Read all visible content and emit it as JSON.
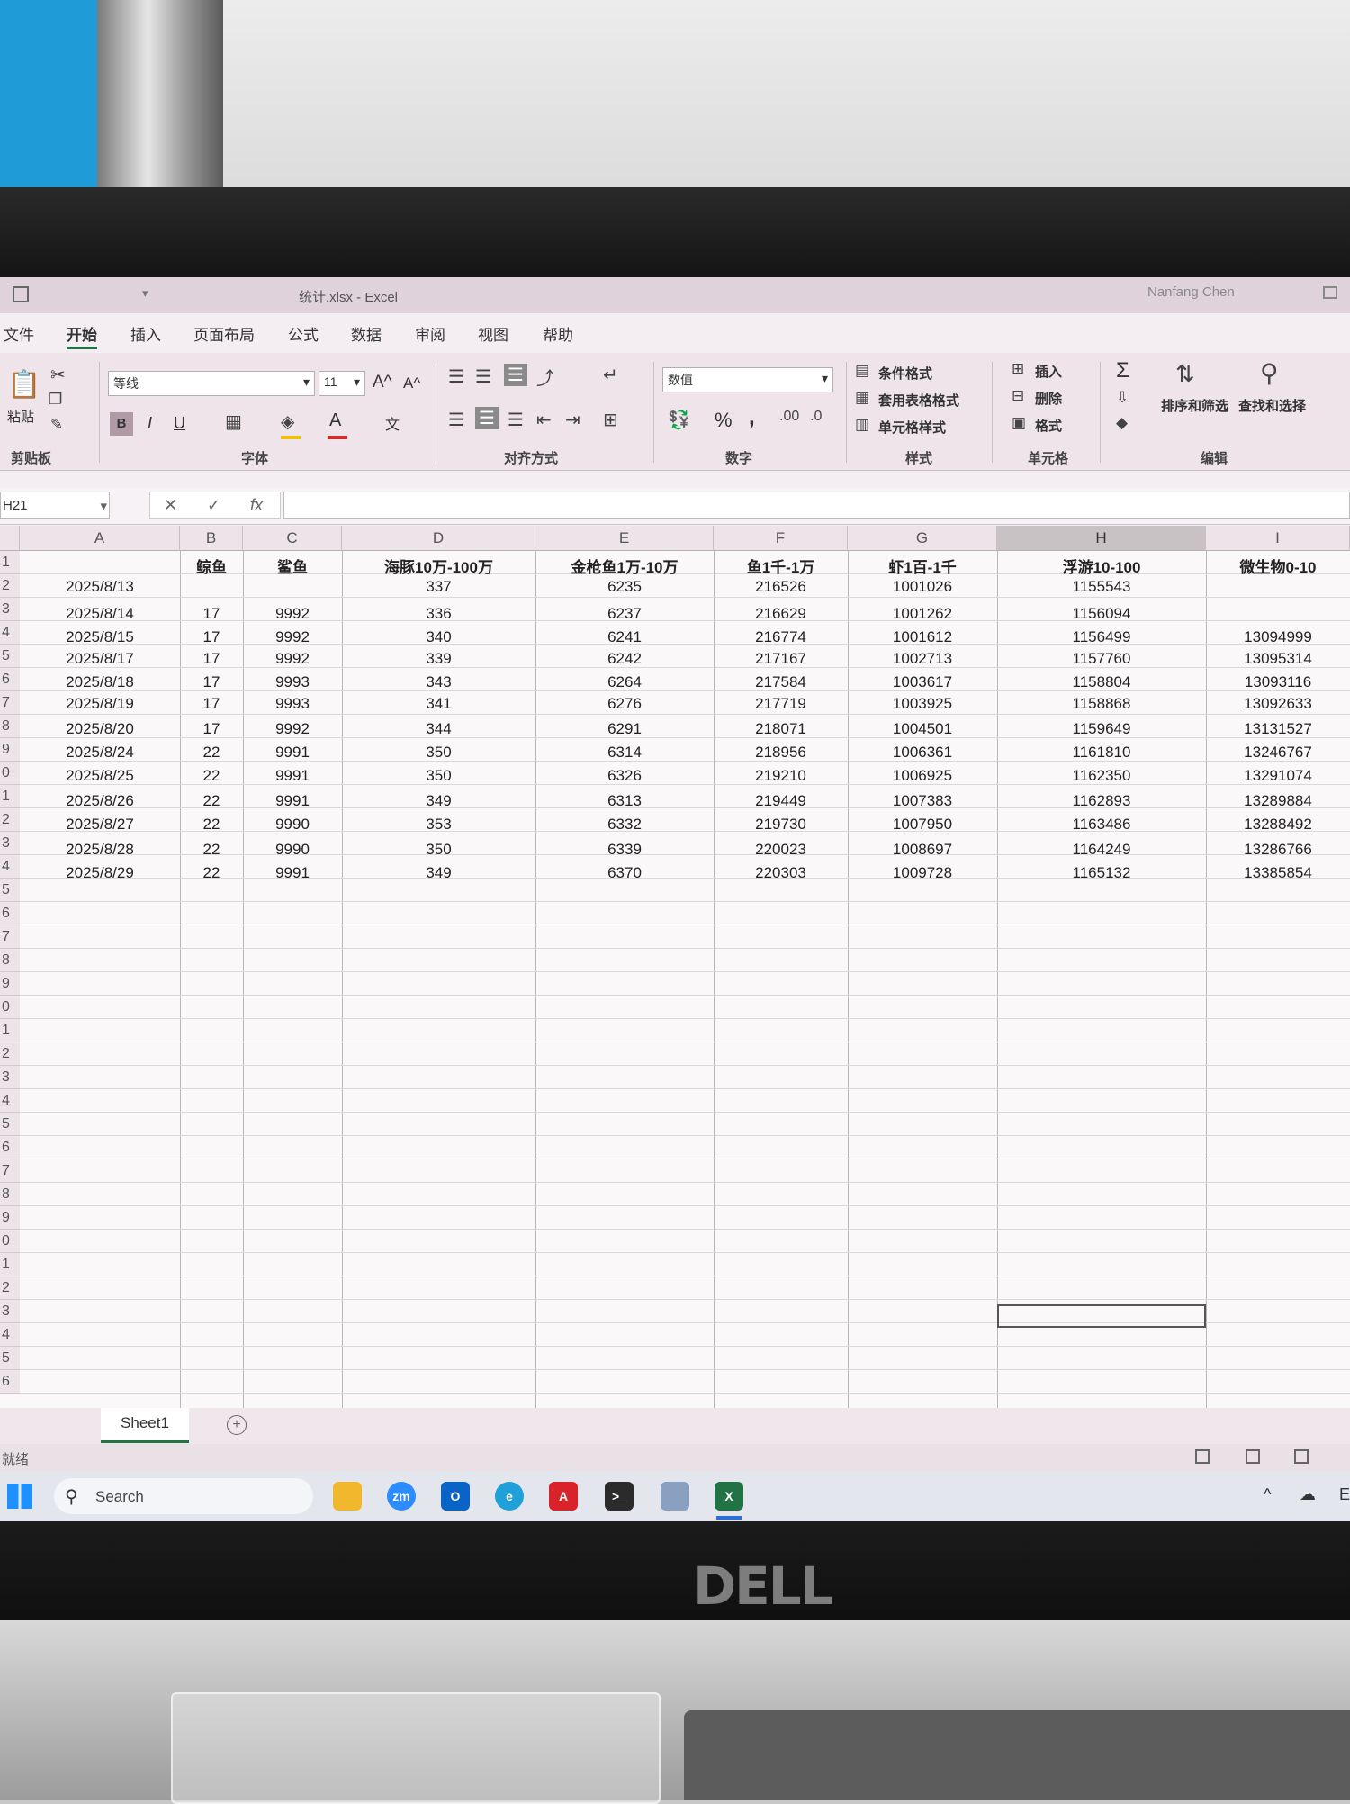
{
  "window": {
    "title": "统计.xlsx  -  Excel",
    "user": "Nanfang Chen",
    "qa_arrow": "▾"
  },
  "menu": [
    "文件",
    "开始",
    "插入",
    "页面布局",
    "公式",
    "数据",
    "审阅",
    "视图",
    "帮助"
  ],
  "ribbon": {
    "clipboard": {
      "paste": "粘贴",
      "label": "剪贴板"
    },
    "font": {
      "name": "等线",
      "size": "11",
      "grow": "A^",
      "shrink": "A^",
      "bold": "B",
      "italic": "I",
      "underline": "U",
      "color": "A",
      "phonetic": "文",
      "label": "字体"
    },
    "alignment": {
      "label": "对齐方式"
    },
    "number": {
      "format": "数值",
      "percent": "%",
      "comma": ",",
      "label": "数字"
    },
    "styles": {
      "conditional": "条件格式",
      "table": "套用表格格式",
      "cell_styles": "单元格样式",
      "label": "样式"
    },
    "cells": {
      "insert": "插入",
      "delete": "删除",
      "format": "格式",
      "label": "单元格"
    },
    "editing": {
      "sort_filter": "排序和筛选",
      "find_select": "查找和选择",
      "sum": "Σ",
      "label": "编辑"
    }
  },
  "formula_bar": {
    "name_box": "H21",
    "cancel": "✕",
    "enter": "✓",
    "fx": "fx",
    "value": ""
  },
  "columns": [
    "A",
    "B",
    "C",
    "D",
    "E",
    "F",
    "G",
    "H",
    "I"
  ],
  "selected_column": "H",
  "row_numbers": [
    "1",
    "2",
    "3",
    "4",
    "5",
    "6",
    "7",
    "8",
    "9",
    "0",
    "1",
    "2",
    "3",
    "4",
    "5",
    "6",
    "7",
    "8",
    "9",
    "0",
    "1",
    "2",
    "3",
    "4",
    "5",
    "6",
    "7",
    "8",
    "9",
    "0",
    "1",
    "2",
    "3",
    "4",
    "5",
    "6"
  ],
  "headers": [
    "",
    "鲸鱼",
    "鲨鱼",
    "海豚10万-100万",
    "金枪鱼1万-10万",
    "鱼1千-1万",
    "虾1百-1千",
    "浮游10-100",
    "微生物0-10"
  ],
  "rows": [
    [
      "2025/8/13",
      "",
      "",
      "337",
      "6235",
      "216526",
      "1001026",
      "1155543",
      ""
    ],
    [
      "2025/8/14",
      "17",
      "9992",
      "336",
      "6237",
      "216629",
      "1001262",
      "1156094",
      ""
    ],
    [
      "2025/8/15",
      "17",
      "9992",
      "340",
      "6241",
      "216774",
      "1001612",
      "1156499",
      "13094999"
    ],
    [
      "2025/8/17",
      "17",
      "9992",
      "339",
      "6242",
      "217167",
      "1002713",
      "1157760",
      "13095314"
    ],
    [
      "2025/8/18",
      "17",
      "9993",
      "343",
      "6264",
      "217584",
      "1003617",
      "1158804",
      "13093116"
    ],
    [
      "2025/8/19",
      "17",
      "9993",
      "341",
      "6276",
      "217719",
      "1003925",
      "1158868",
      "13092633"
    ],
    [
      "2025/8/20",
      "17",
      "9992",
      "344",
      "6291",
      "218071",
      "1004501",
      "1159649",
      "13131527"
    ],
    [
      "2025/8/24",
      "22",
      "9991",
      "350",
      "6314",
      "218956",
      "1006361",
      "1161810",
      "13246767"
    ],
    [
      "2025/8/25",
      "22",
      "9991",
      "350",
      "6326",
      "219210",
      "1006925",
      "1162350",
      "13291074"
    ],
    [
      "2025/8/26",
      "22",
      "9991",
      "349",
      "6313",
      "219449",
      "1007383",
      "1162893",
      "13289884"
    ],
    [
      "2025/8/27",
      "22",
      "9990",
      "353",
      "6332",
      "219730",
      "1007950",
      "1163486",
      "13288492"
    ],
    [
      "2025/8/28",
      "22",
      "9990",
      "350",
      "6339",
      "220023",
      "1008697",
      "1164249",
      "13286766"
    ],
    [
      "2025/8/29",
      "22",
      "9991",
      "349",
      "6370",
      "220303",
      "1009728",
      "1165132",
      "13385854"
    ]
  ],
  "sheet_tabs": [
    "Sheet1"
  ],
  "add_sheet": "+",
  "status": {
    "mode": "就绪"
  },
  "taskbar": {
    "search_placeholder": "Search",
    "zoom_label": "zm",
    "outlook_label": "O",
    "excel_label": "X",
    "edge_label": "e",
    "acrobat_label": "A",
    "terminal_label": ">_",
    "tray_chevron": "^",
    "tray_letter": "E"
  },
  "monitor": {
    "brand": "DELL"
  },
  "colors": {
    "excel_green": "#217346",
    "ribbon_bg": "#efe4ea",
    "grid_bg": "#fbf8fa",
    "wall_blue": "#1f9bd8"
  }
}
